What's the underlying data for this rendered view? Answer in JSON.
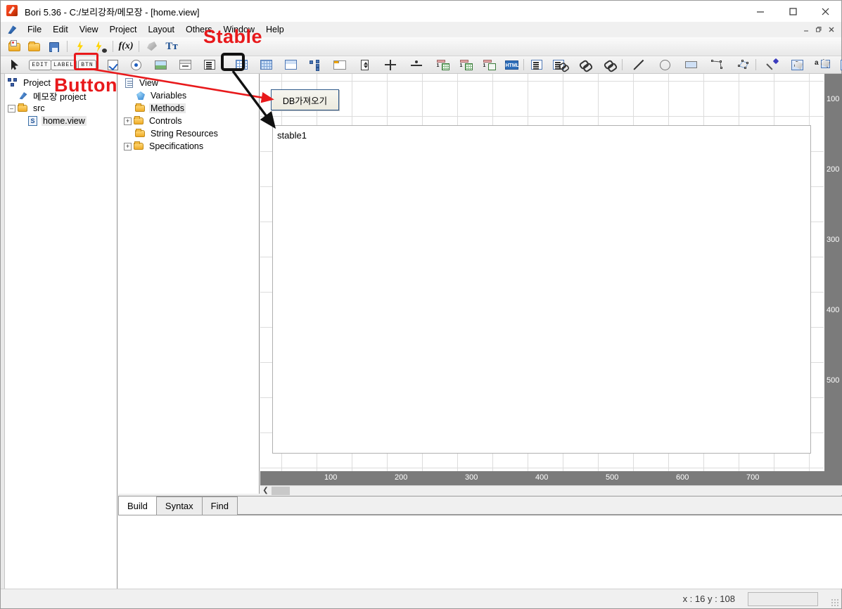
{
  "window": {
    "title": "Bori 5.36 - C:/보리강좌/메모장 - [home.view]",
    "app_icon": "feather-icon",
    "minimize": "–",
    "maximize": "□",
    "close": "✕",
    "mdi_minimize": "–",
    "mdi_restore": "❐",
    "mdi_close": "✕"
  },
  "menu": {
    "app_icon": "quill-icon",
    "items": [
      {
        "label": "File"
      },
      {
        "label": "Edit"
      },
      {
        "label": "View"
      },
      {
        "label": "Project"
      },
      {
        "label": "Layout"
      },
      {
        "label": "Others"
      },
      {
        "label": "Window"
      },
      {
        "label": "Help"
      }
    ]
  },
  "toolbar_main": [
    {
      "name": "new-file-icon",
      "type": "icon"
    },
    {
      "name": "open-folder-icon",
      "type": "icon"
    },
    {
      "name": "save-icon",
      "type": "icon"
    },
    {
      "name": "separator",
      "type": "sep"
    },
    {
      "name": "run-icon",
      "type": "icon"
    },
    {
      "name": "debug-icon",
      "type": "icon"
    },
    {
      "name": "separator",
      "type": "sep"
    },
    {
      "name": "function-icon",
      "label": "f(x)",
      "type": "icon"
    },
    {
      "name": "separator",
      "type": "sep"
    },
    {
      "name": "fill-color-icon",
      "type": "icon"
    },
    {
      "name": "font-icon",
      "label": "Tт",
      "type": "icon"
    }
  ],
  "toolbar_controls": [
    {
      "name": "select-pointer-tool",
      "kind": "pointer"
    },
    {
      "name": "edit-control-tool",
      "kind": "text",
      "label": "EDIT"
    },
    {
      "name": "label-control-tool",
      "kind": "text",
      "label": "LABEL"
    },
    {
      "name": "button-control-tool",
      "kind": "text",
      "label": "BTN"
    },
    {
      "name": "checkbox-control-tool",
      "kind": "check"
    },
    {
      "name": "radio-control-tool",
      "kind": "radio"
    },
    {
      "name": "image-control-tool",
      "kind": "image"
    },
    {
      "name": "groupbox-control-tool",
      "kind": "group"
    },
    {
      "name": "listbox-control-tool",
      "kind": "list"
    },
    {
      "name": "grid-control-tool",
      "kind": "grid"
    },
    {
      "name": "stable-control-tool",
      "kind": "grid-blue"
    },
    {
      "name": "dtable-control-tool",
      "kind": "grid-mixed"
    },
    {
      "name": "tree-control-tool",
      "kind": "tree"
    },
    {
      "name": "tab-control-tool",
      "kind": "window"
    },
    {
      "name": "spin-control-tool",
      "kind": "spin"
    },
    {
      "name": "align-horizontal-tool",
      "kind": "halign"
    },
    {
      "name": "align-vertical-tool",
      "kind": "valign"
    },
    {
      "name": "numgrid-1-tool",
      "kind": "numgrid"
    },
    {
      "name": "numgrid-2-tool",
      "kind": "numgrid"
    },
    {
      "name": "numgrid-3-tool",
      "kind": "numgrid"
    },
    {
      "name": "html-control-tool",
      "kind": "html",
      "label": "HTML"
    },
    {
      "name": "separator",
      "kind": "sep"
    },
    {
      "name": "property-list-tool",
      "kind": "proplist"
    },
    {
      "name": "link-property-tool",
      "kind": "linkprop"
    },
    {
      "name": "link-tool",
      "kind": "link"
    },
    {
      "name": "link-break-tool",
      "kind": "link"
    },
    {
      "name": "separator",
      "kind": "sep"
    },
    {
      "name": "line-draw-tool",
      "kind": "line"
    },
    {
      "name": "ellipse-draw-tool",
      "kind": "circle"
    },
    {
      "name": "rectangle-draw-tool",
      "kind": "rect"
    },
    {
      "name": "polyline-draw-tool",
      "kind": "polyline"
    },
    {
      "name": "polygon-draw-tool",
      "kind": "polygon"
    },
    {
      "name": "separator",
      "kind": "sep"
    },
    {
      "name": "eyedropper-tool",
      "kind": "dropper"
    },
    {
      "name": "fill-bucket-tool",
      "kind": "bucket"
    },
    {
      "name": "text-fill-tool",
      "kind": "bucket-text"
    },
    {
      "name": "border-fill-tool",
      "kind": "bucket-border"
    }
  ],
  "project_tree": {
    "root_label": "Project",
    "items": [
      {
        "label": "Project",
        "icon": "project-icon",
        "indent": 0,
        "expander": ""
      },
      {
        "label": "메모장 project",
        "icon": "app-icon",
        "indent": 1,
        "expander": ""
      },
      {
        "label": "src",
        "icon": "folder-icon",
        "indent": 0,
        "expander": "–"
      },
      {
        "label": "home.view",
        "icon": "view-file-icon",
        "indent": 1,
        "expander": "",
        "selected": true
      }
    ]
  },
  "outline_tree": {
    "items": [
      {
        "label": "View",
        "icon": "document-icon",
        "indent": 0,
        "expander": ""
      },
      {
        "label": "Variables",
        "icon": "gem-icon",
        "indent": 1,
        "expander": ""
      },
      {
        "label": "Methods",
        "icon": "folder-icon",
        "indent": 1,
        "expander": "",
        "selected": true
      },
      {
        "label": "Controls",
        "icon": "folder-icon",
        "indent": 1,
        "expander": "+"
      },
      {
        "label": "String Resources",
        "icon": "folder-icon",
        "indent": 1,
        "expander": ""
      },
      {
        "label": "Specifications",
        "icon": "folder-icon",
        "indent": 1,
        "expander": "+"
      }
    ]
  },
  "canvas": {
    "db_button_label": "DB가져오기",
    "stable_label": "stable1"
  },
  "rulers": {
    "horizontal_ticks": [
      "100",
      "200",
      "300",
      "400",
      "500",
      "600",
      "700"
    ],
    "vertical_ticks": [
      "100",
      "200",
      "300",
      "400",
      "500"
    ]
  },
  "scrollbar": {
    "left_arrow": "❮"
  },
  "bottom_tabs": [
    {
      "label": "Build",
      "active": true
    },
    {
      "label": "Syntax",
      "active": false
    },
    {
      "label": "Find",
      "active": false
    }
  ],
  "statusbar": {
    "coordinates": "x : 16  y : 108"
  },
  "annotations": {
    "stable_text": "Stable",
    "button_text": "Button",
    "stable_color": "#e8191b",
    "button_color": "#e8191b",
    "red_box_color": "#e8191b",
    "black_box_color": "#111111"
  }
}
